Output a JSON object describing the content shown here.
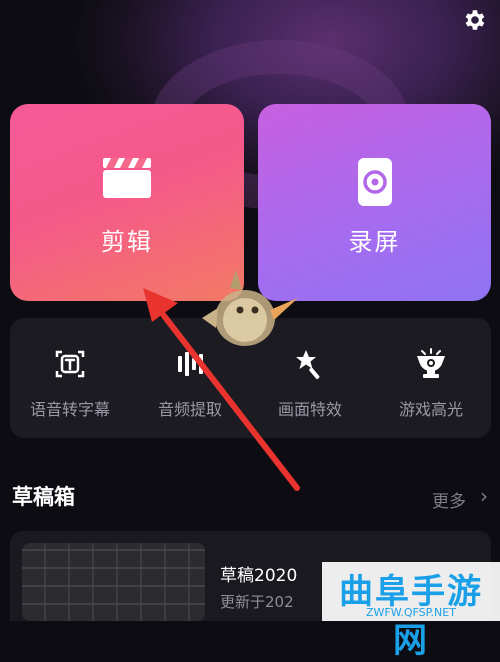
{
  "header": {
    "settings_icon": "gear-icon"
  },
  "cards": [
    {
      "label": "剪辑",
      "icon": "clapperboard-icon",
      "color_start": "#f55a97",
      "color_end": "#f27a64"
    },
    {
      "label": "录屏",
      "icon": "screen-record-icon",
      "color_start": "#c760e0",
      "color_end": "#8f73f3"
    }
  ],
  "tools": [
    {
      "label": "语音转字幕",
      "icon": "text-recognition-icon"
    },
    {
      "label": "音频提取",
      "icon": "audio-waveform-icon"
    },
    {
      "label": "画面特效",
      "icon": "magic-wand-icon"
    },
    {
      "label": "游戏高光",
      "icon": "trophy-icon"
    }
  ],
  "drafts": {
    "title": "草稿箱",
    "more_label": "更多",
    "items": [
      {
        "title": "草稿2020",
        "subtitle": "更新于202"
      }
    ]
  },
  "watermark": {
    "title": "曲阜手游网",
    "url": "ZWFW.QFSP.NET"
  },
  "annotation": {
    "arrow_color": "#e8332e"
  }
}
